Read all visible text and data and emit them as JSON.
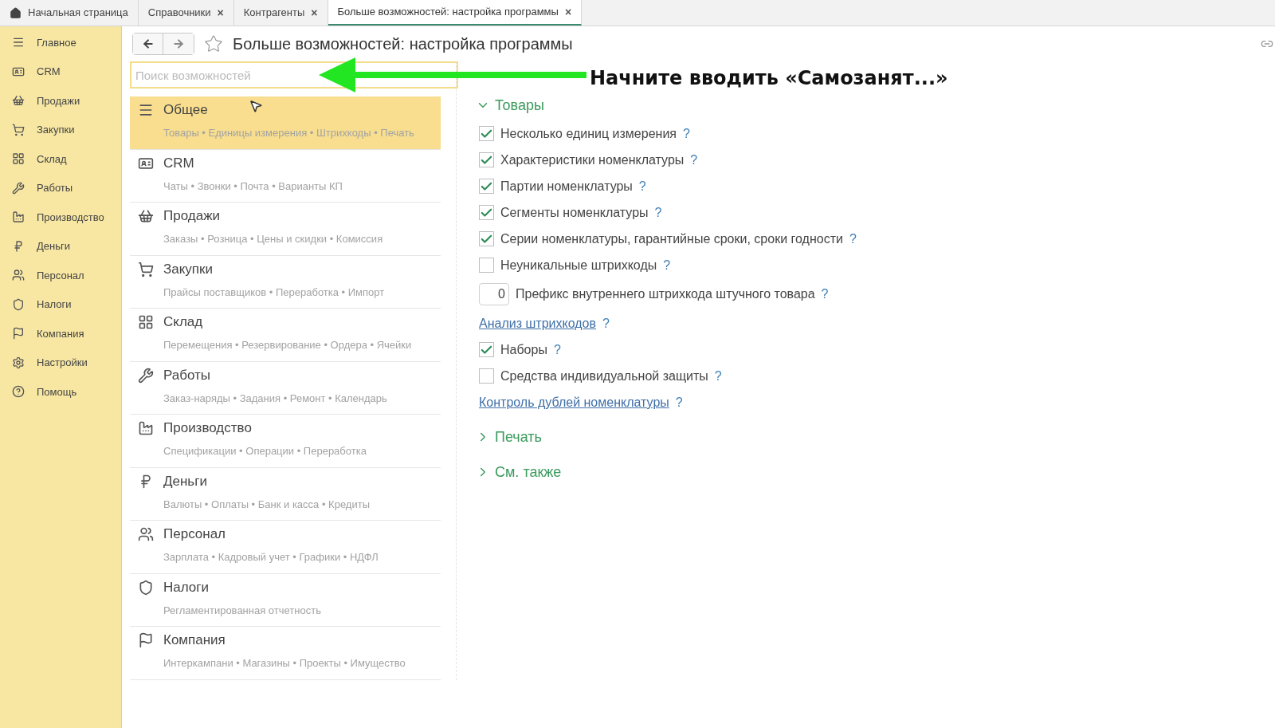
{
  "tabs": [
    {
      "kind": "home",
      "label": "Начальная страница",
      "selected": false
    },
    {
      "kind": "tab",
      "label": "Справочники",
      "close": "×",
      "selected": false
    },
    {
      "kind": "tab",
      "label": "Контрагенты",
      "close": "×",
      "selected": false
    },
    {
      "kind": "tab",
      "label": "Больше возможностей: настройка программы",
      "close": "×",
      "selected": true
    }
  ],
  "sidebar": {
    "items": [
      {
        "label": "Главное"
      },
      {
        "label": "CRM"
      },
      {
        "label": "Продажи"
      },
      {
        "label": "Закупки"
      },
      {
        "label": "Склад"
      },
      {
        "label": "Работы"
      },
      {
        "label": "Производство"
      },
      {
        "label": "Деньги"
      },
      {
        "label": "Персонал"
      },
      {
        "label": "Налоги"
      },
      {
        "label": "Компания"
      },
      {
        "label": "Настройки"
      },
      {
        "label": "Помощь"
      }
    ]
  },
  "window": {
    "title": "Больше возможностей: настройка программы",
    "favorite": false
  },
  "search": {
    "placeholder": "Поиск возможностей"
  },
  "annotation": {
    "text": "Начните вводить «Самозанят...»"
  },
  "sections": [
    {
      "title": "Общее",
      "details": "Товары • Единицы измерения • Штрихкоды • Печать",
      "selected": true
    },
    {
      "title": "CRM",
      "details": "Чаты • Звонки • Почта • Варианты КП",
      "selected": false
    },
    {
      "title": "Продажи",
      "details": "Заказы • Розница • Цены и скидки • Комиссия",
      "selected": false
    },
    {
      "title": "Закупки",
      "details": "Прайсы поставщиков • Переработка • Импорт",
      "selected": false
    },
    {
      "title": "Склад",
      "details": "Перемещения • Резервирование • Ордера • Ячейки",
      "selected": false
    },
    {
      "title": "Работы",
      "details": "Заказ-наряды • Задания • Ремонт • Календарь",
      "selected": false
    },
    {
      "title": "Производство",
      "details": "Спецификации • Операции • Переработка",
      "selected": false
    },
    {
      "title": "Деньги",
      "details": "Валюты • Оплаты • Банк и касса • Кредиты",
      "selected": false
    },
    {
      "title": "Персонал",
      "details": "Зарплата • Кадровый учет • Графики • НДФЛ",
      "selected": false
    },
    {
      "title": "Налоги",
      "details": "Регламентированная отчетность",
      "selected": false
    },
    {
      "title": "Компания",
      "details": "Интеркампани • Магазины • Проекты • Имущество",
      "selected": false
    }
  ],
  "groups": [
    {
      "title": "Товары",
      "expanded": true,
      "items": [
        {
          "kind": "checkbox",
          "label": "Несколько единиц измерения",
          "checked": true,
          "help": "?"
        },
        {
          "kind": "checkbox",
          "label": "Характеристики номенклатуры",
          "checked": true,
          "help": "?"
        },
        {
          "kind": "checkbox",
          "label": "Партии номенклатуры",
          "checked": true,
          "help": "?"
        },
        {
          "kind": "checkbox",
          "label": "Сегменты номенклатуры",
          "checked": true,
          "help": "?"
        },
        {
          "kind": "checkbox",
          "label": "Серии номенклатуры, гарантийные сроки, сроки годности",
          "checked": true,
          "help": "?"
        },
        {
          "kind": "checkbox",
          "label": "Неуникальные штрихкоды",
          "checked": false,
          "help": "?"
        },
        {
          "kind": "number",
          "value": "0",
          "label": "Префикс внутреннего штрихкода штучного товара",
          "help": "?"
        },
        {
          "kind": "link",
          "label": "Анализ штрихкодов",
          "help": "?"
        },
        {
          "kind": "checkbox",
          "label": "Наборы",
          "checked": true,
          "help": "?"
        },
        {
          "kind": "checkbox",
          "label": "Средства индивидуальной защиты",
          "checked": false,
          "help": "?"
        },
        {
          "kind": "link",
          "label": "Контроль дублей номенклатуры",
          "help": "?"
        }
      ]
    },
    {
      "title": "Печать",
      "expanded": false
    },
    {
      "title": "См. также",
      "expanded": false
    }
  ]
}
